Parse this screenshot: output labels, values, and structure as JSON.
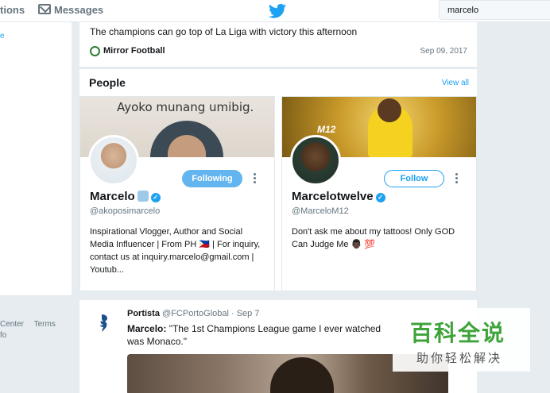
{
  "nav": {
    "notifications_label": "tions",
    "messages_label": "Messages",
    "search_value": "marcelo"
  },
  "left": {
    "link_fragment": "e",
    "footer_links": [
      "Center",
      "Terms",
      "fo"
    ]
  },
  "top_tweet": {
    "text": "The champions can go top of La Liga with victory this afternoon",
    "source": "Mirror Football",
    "date": "Sep 09, 2017"
  },
  "people": {
    "title": "People",
    "view_all": "View all",
    "cards": [
      {
        "banner_text": "Ayoko munang umibig.",
        "name": "Marcelo",
        "handle": "@akoposimarcelo",
        "button": "Following",
        "bio": "Inspirational Vlogger, Author and Social Media Influencer | From PH 🇵🇭 | For inquiry, contact us at inquiry.marcelo@gmail.com | Youtub..."
      },
      {
        "banner_text": "M12",
        "name": "Marcelotwelve",
        "handle": "@MarceloM12",
        "button": "Follow",
        "bio": "Don't ask me about my tattoos! Only GOD Can Judge Me 👨🏿 💯"
      }
    ]
  },
  "tweet2": {
    "name": "Portista",
    "meta": "@FCPortoGlobal · Sep 7",
    "body_bold": "Marcelo:",
    "body": " \"The 1st Champions League game I ever watched was Monaco.\""
  },
  "watermark": {
    "big": "百科全说",
    "small": "助你轻松解决"
  },
  "colors": {
    "accent": "#1da1f2",
    "background": "#e6ecf0"
  }
}
